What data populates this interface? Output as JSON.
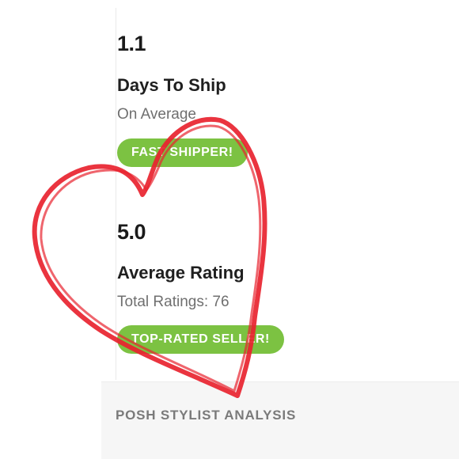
{
  "shipping": {
    "value": "1.1",
    "label": "Days To Ship",
    "sub": "On Average",
    "badge": "FAST SHIPPER!"
  },
  "rating": {
    "value": "5.0",
    "label": "Average Rating",
    "sub": "Total Ratings: 76",
    "badge": "TOP-RATED SELLER!"
  },
  "section": {
    "title": "POSH STYLIST ANALYSIS"
  },
  "colors": {
    "badge_green": "#7cc242",
    "heart_red": "#e8232f"
  },
  "overlay": {
    "icon": "heart-doodle-icon"
  }
}
